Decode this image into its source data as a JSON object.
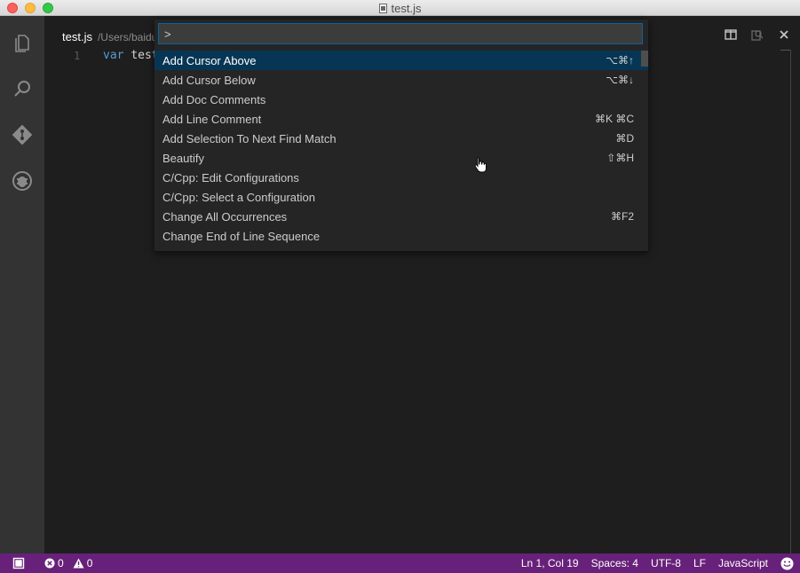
{
  "window": {
    "title": "test.js"
  },
  "editor": {
    "tab_title": "test.js",
    "tab_path": "/Users/baidu",
    "line_number": "1",
    "code_keyword": "var",
    "code_text": "test"
  },
  "palette": {
    "input_value": ">",
    "items": [
      {
        "label": "Add Cursor Above",
        "keybinding": "⌥⌘↑"
      },
      {
        "label": "Add Cursor Below",
        "keybinding": "⌥⌘↓"
      },
      {
        "label": "Add Doc Comments",
        "keybinding": ""
      },
      {
        "label": "Add Line Comment",
        "keybinding": "⌘K ⌘C"
      },
      {
        "label": "Add Selection To Next Find Match",
        "keybinding": "⌘D"
      },
      {
        "label": "Beautify",
        "keybinding": "⇧⌘H"
      },
      {
        "label": "C/Cpp: Edit Configurations",
        "keybinding": ""
      },
      {
        "label": "C/Cpp: Select a Configuration",
        "keybinding": ""
      },
      {
        "label": "Change All Occurrences",
        "keybinding": "⌘F2"
      },
      {
        "label": "Change End of Line Sequence",
        "keybinding": ""
      }
    ]
  },
  "statusbar": {
    "errors": "0",
    "warnings": "0",
    "position": "Ln 1, Col 19",
    "indentation": "Spaces: 4",
    "encoding": "UTF-8",
    "eol": "LF",
    "language": "JavaScript"
  },
  "colors": {
    "statusbar_bg": "#68217a",
    "selected_row": "#073655",
    "activity_bar": "#333333",
    "editor_bg": "#1e1e1e"
  },
  "icons": {
    "activity": [
      "explorer-icon",
      "search-icon",
      "git-icon",
      "debug-icon"
    ],
    "editor_actions": [
      "split-editor-icon",
      "open-changes-icon",
      "close-icon"
    ],
    "status": [
      "feedback-icon",
      "error-icon",
      "warning-icon",
      "smiley-icon"
    ]
  }
}
